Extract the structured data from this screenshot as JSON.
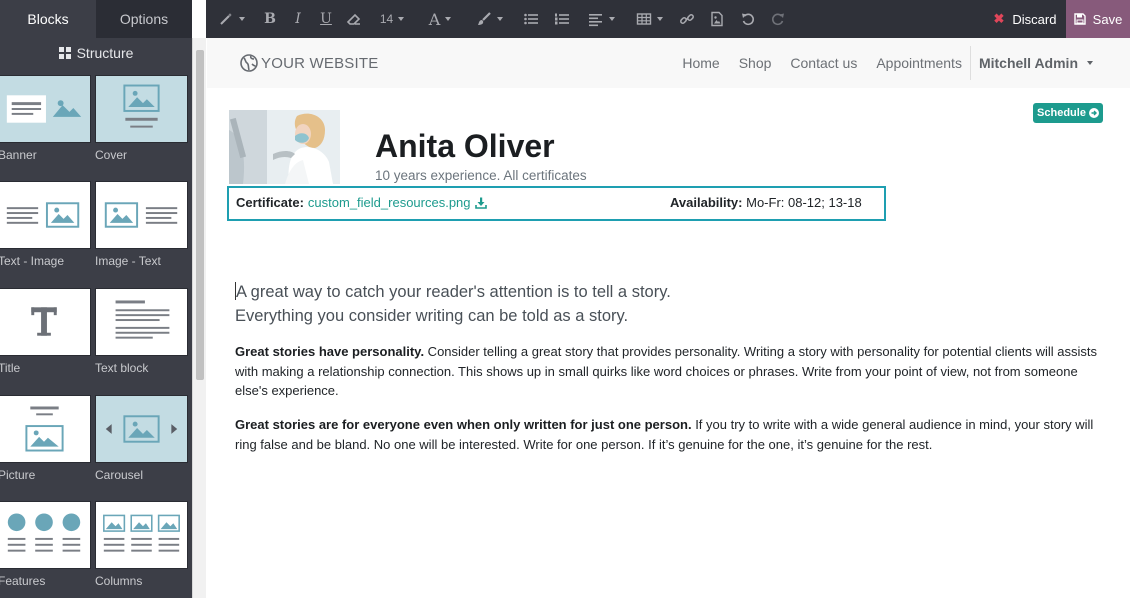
{
  "sidebar": {
    "tabs": [
      {
        "label": "Blocks"
      },
      {
        "label": "Options"
      }
    ],
    "section_title": "Structure",
    "blocks": [
      {
        "label": "Banner"
      },
      {
        "label": "Cover"
      },
      {
        "label": "Text - Image"
      },
      {
        "label": "Image - Text"
      },
      {
        "label": "Title"
      },
      {
        "label": "Text block"
      },
      {
        "label": "Picture"
      },
      {
        "label": "Carousel"
      },
      {
        "label": "Features"
      },
      {
        "label": "Columns"
      }
    ]
  },
  "toolbar": {
    "font_size": "14",
    "discard_label": "Discard",
    "save_label": "Save",
    "icons": [
      "magic-icon",
      "bold-icon",
      "italic-icon",
      "underline-icon",
      "eraser-icon",
      "font-size-select",
      "font-color-icon",
      "brush-icon",
      "unordered-list-icon",
      "ordered-list-icon",
      "align-icon",
      "table-icon",
      "link-icon",
      "image-icon",
      "undo-icon",
      "redo-icon"
    ]
  },
  "navbar": {
    "brand": "YOUR WEBSITE",
    "links": [
      {
        "label": "Home"
      },
      {
        "label": "Shop"
      },
      {
        "label": "Contact us"
      },
      {
        "label": "Appointments"
      }
    ],
    "user": "Mitchell Admin"
  },
  "profile": {
    "schedule_label": "Schedule",
    "name": "Anita Oliver",
    "subtitle": "10 years experience. All certificates",
    "certificate_label": "Certificate:",
    "certificate_file": "custom_field_resources.png",
    "availability_label": "Availability:",
    "availability_value": "Mo-Fr: 08-12; 13-18"
  },
  "content": {
    "lead_line1": "A great way to catch your reader's attention is to tell a story.",
    "lead_line2": "Everything you consider writing can be told as a story.",
    "para1_bold": "Great stories have personality.",
    "para1_text": " Consider telling a great story that provides personality. Writing a story with personality for potential clients will assists with making a relationship connection. This shows up in small quirks like word choices or phrases. Write from your point of view, not from someone else's experience.",
    "para2_bold": "Great stories are for everyone even when only written for just one person.",
    "para2_text": " If you try to write with a wide general audience in mind, your story will ring false and be bland. No one will be interested. Write for one person. If it’s genuine for the one, it’s genuine for the rest."
  },
  "colors": {
    "accent": "#1d9b8e",
    "save_button": "#875a7b",
    "discard_icon": "#e0465a",
    "focus_border": "#1e9fb1"
  }
}
